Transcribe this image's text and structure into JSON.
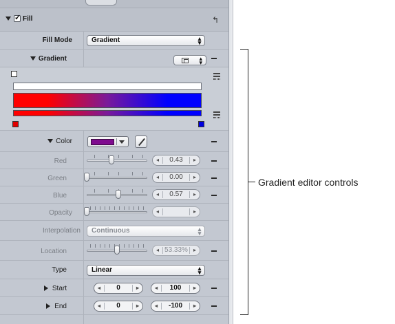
{
  "fill": {
    "title": "Fill",
    "checked": true
  },
  "fill_mode": {
    "label": "Fill Mode",
    "value": "Gradient"
  },
  "gradient": {
    "label": "Gradient"
  },
  "color": {
    "label": "Color",
    "swatch": "#7f0b8f"
  },
  "params": [
    {
      "label": "Red",
      "value": "0.43"
    },
    {
      "label": "Green",
      "value": "0.00"
    },
    {
      "label": "Blue",
      "value": "0.57"
    },
    {
      "label": "Opacity",
      "value": ""
    }
  ],
  "interpolation": {
    "label": "Interpolation",
    "value": "Continuous"
  },
  "location": {
    "label": "Location",
    "value": "53.33%"
  },
  "type": {
    "label": "Type",
    "value": "Linear"
  },
  "start": {
    "label": "Start",
    "x": "0",
    "y": "100"
  },
  "end": {
    "label": "End",
    "x": "0",
    "y": "-100"
  },
  "colors": {
    "gradient_left": "#ff0000",
    "gradient_right": "#0000ff",
    "stop_left": "#e00000",
    "stop_right": "#0000e0"
  },
  "callout": {
    "text": "Gradient editor controls"
  }
}
